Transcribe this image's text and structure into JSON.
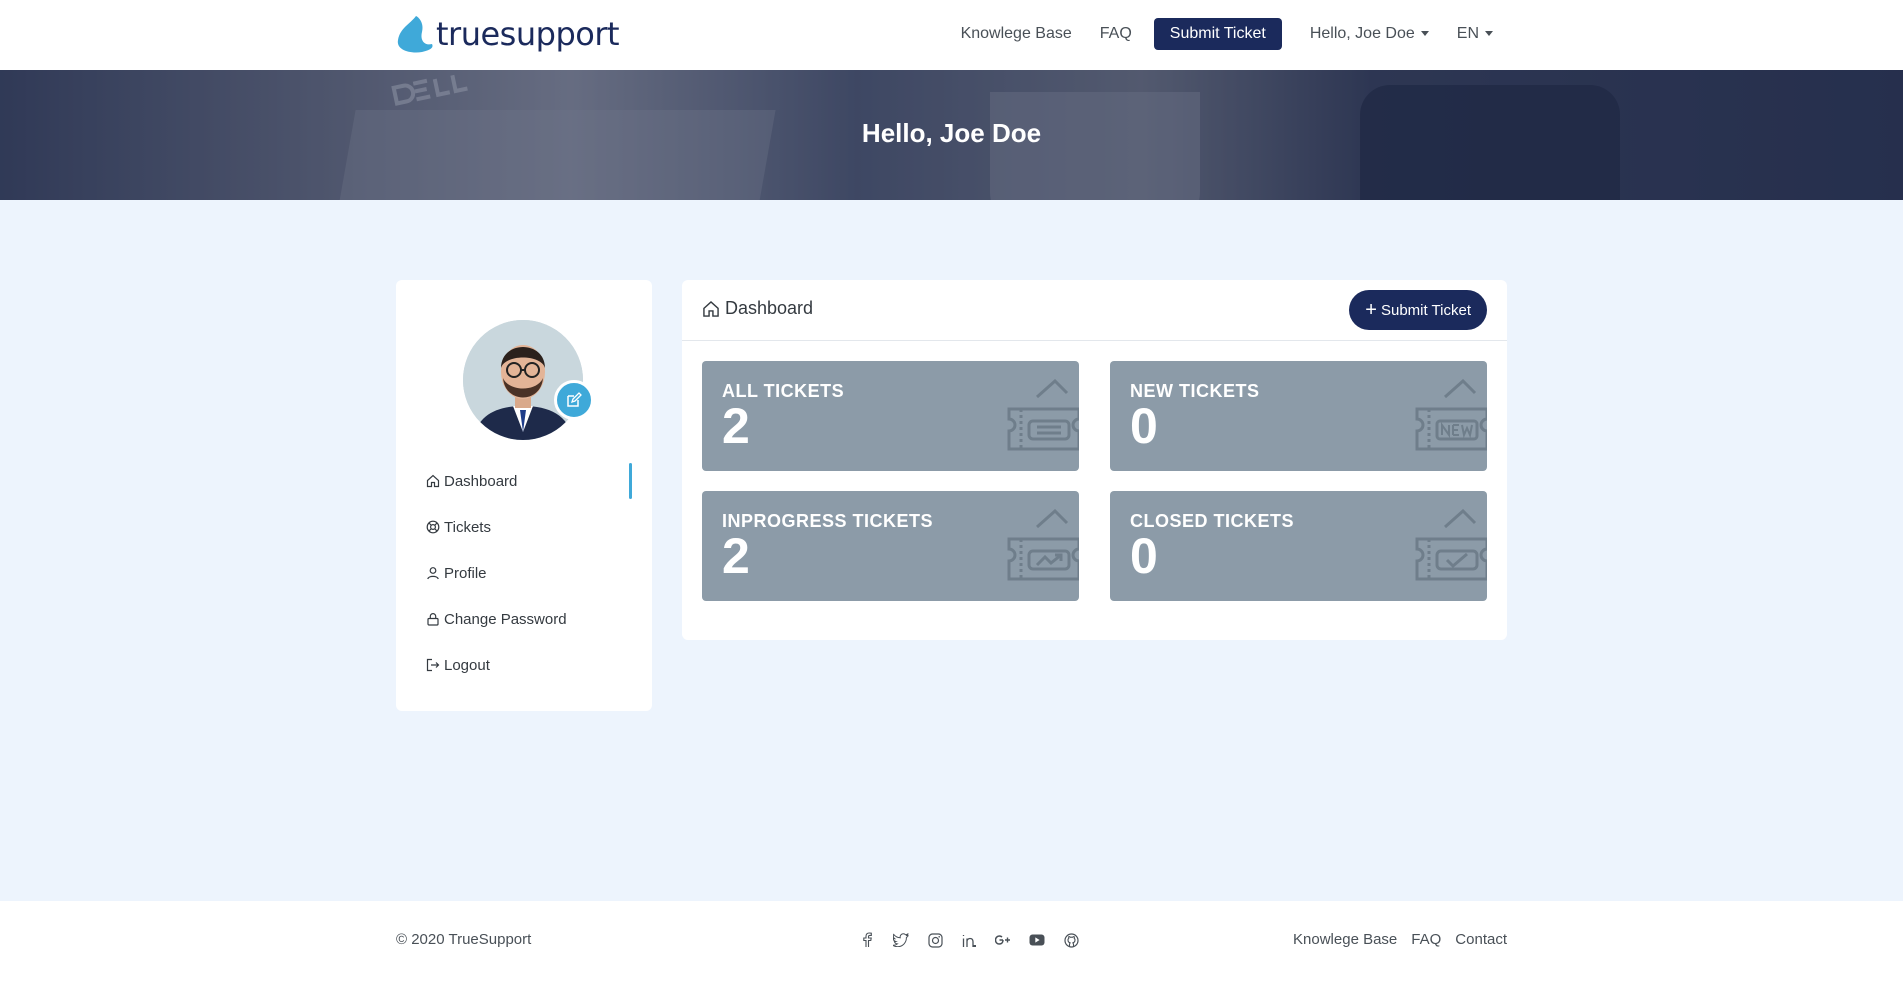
{
  "header": {
    "logo_text": "truesupport",
    "nav": {
      "knowledge_base": "Knowlege Base",
      "faq": "FAQ",
      "submit_ticket": "Submit Ticket",
      "user_menu": "Hello, Joe Doe",
      "language": "EN"
    }
  },
  "hero": {
    "title": "Hello, Joe Doe"
  },
  "sidebar": {
    "items": [
      {
        "label": "Dashboard",
        "icon": "home-icon",
        "active": true
      },
      {
        "label": "Tickets",
        "icon": "lifebuoy-icon"
      },
      {
        "label": "Profile",
        "icon": "user-icon"
      },
      {
        "label": "Change Password",
        "icon": "lock-icon"
      },
      {
        "label": "Logout",
        "icon": "logout-icon"
      }
    ]
  },
  "dashboard": {
    "title": "Dashboard",
    "submit_button": "Submit Ticket",
    "cards": [
      {
        "label": "ALL TICKETS",
        "value": "2",
        "icon": "ticket-list-icon"
      },
      {
        "label": "NEW TICKETS",
        "value": "0",
        "icon": "ticket-new-icon"
      },
      {
        "label": "INPROGRESS TICKETS",
        "value": "2",
        "icon": "ticket-progress-icon"
      },
      {
        "label": "CLOSED TICKETS",
        "value": "0",
        "icon": "ticket-check-icon"
      }
    ]
  },
  "footer": {
    "copyright": "© 2020 TrueSupport",
    "social_icons": [
      "facebook-icon",
      "twitter-icon",
      "instagram-icon",
      "linkedin-icon",
      "google-plus-icon",
      "youtube-icon",
      "github-icon"
    ],
    "links": {
      "knowledge_base": "Knowlege Base",
      "faq": "FAQ",
      "contact": "Contact"
    }
  },
  "colors": {
    "brand_navy": "#1b2a5c",
    "accent_blue": "#3fa9d9",
    "card_gray": "#8c9ba8",
    "page_background": "#edf4fd"
  }
}
